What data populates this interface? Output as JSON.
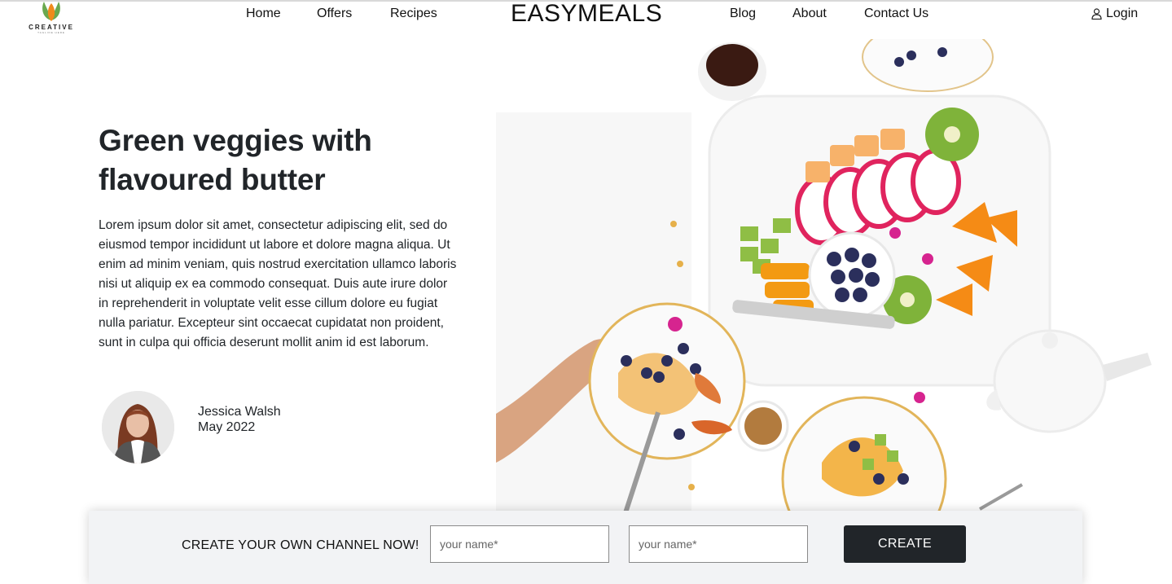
{
  "header": {
    "logo_word": "CREATIVE",
    "logo_tagline": "TAGLINE HERE",
    "brand": "EASYMEALS",
    "nav_left": [
      "Home",
      "Offers",
      "Recipes"
    ],
    "nav_right": [
      "Blog",
      "About",
      "Contact Us"
    ],
    "login_label": "Login",
    "login_icon": "user-icon"
  },
  "hero": {
    "title": "Green veggies with flavoured butter",
    "body": "Lorem ipsum dolor sit amet, consectetur adipiscing elit, sed do eiusmod tempor incididunt ut labore et dolore magna aliqua. Ut enim ad minim veniam, quis nostrud exercitation ullamco laboris nisi ut aliquip ex ea commodo consequat. Duis aute irure dolor in reprehenderit in voluptate velit esse cillum dolore eu fugiat nulla pariatur. Excepteur sint occaecat cupidatat non proident, sunt in culpa qui officia deserunt mollit anim id est laborum.",
    "author_name": "Jessica Walsh",
    "author_date": "May 2022"
  },
  "channel": {
    "label": "CREATE YOUR OWN CHANNEL NOW!",
    "input1_placeholder": "your name*",
    "input2_placeholder": "your name*",
    "button_label": "CREATE"
  },
  "colors": {
    "accent_dark": "#212529",
    "logo_orange": "#f08a1c",
    "logo_green": "#6aa84f",
    "channel_bg": "#f2f3f5"
  }
}
